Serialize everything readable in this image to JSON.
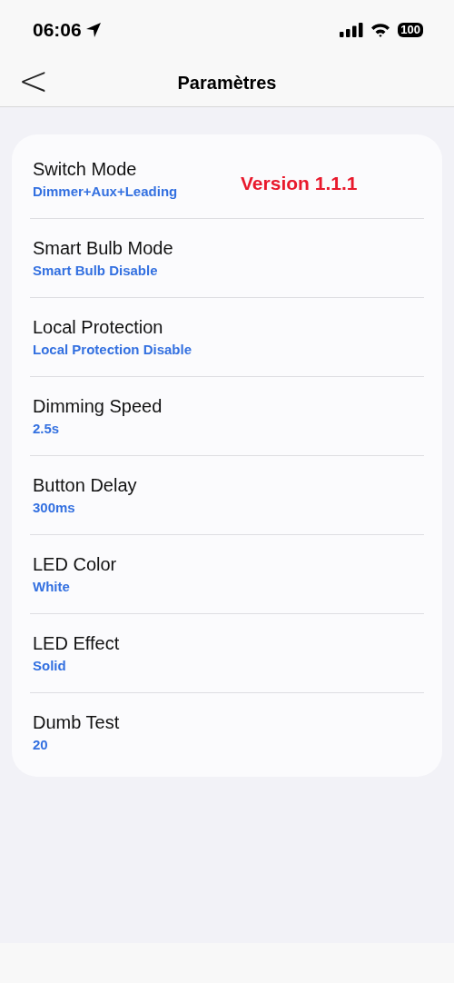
{
  "status_bar": {
    "time": "06:06",
    "battery": "100"
  },
  "nav_bar": {
    "back": "<",
    "title": "Paramètres"
  },
  "settings": [
    {
      "title": "Switch Mode",
      "value": "Dimmer+Aux+Leading"
    },
    {
      "title": "Smart Bulb Mode",
      "value": "Smart Bulb Disable"
    },
    {
      "title": "Local Protection",
      "value": "Local Protection Disable"
    },
    {
      "title": "Dimming Speed",
      "value": "2.5s"
    },
    {
      "title": "Button Delay",
      "value": "300ms"
    },
    {
      "title": "LED Color",
      "value": "White"
    },
    {
      "title": "LED Effect",
      "value": "Solid"
    },
    {
      "title": "Dumb Test",
      "value": "20"
    }
  ],
  "version_label": "Version 1.1.1"
}
